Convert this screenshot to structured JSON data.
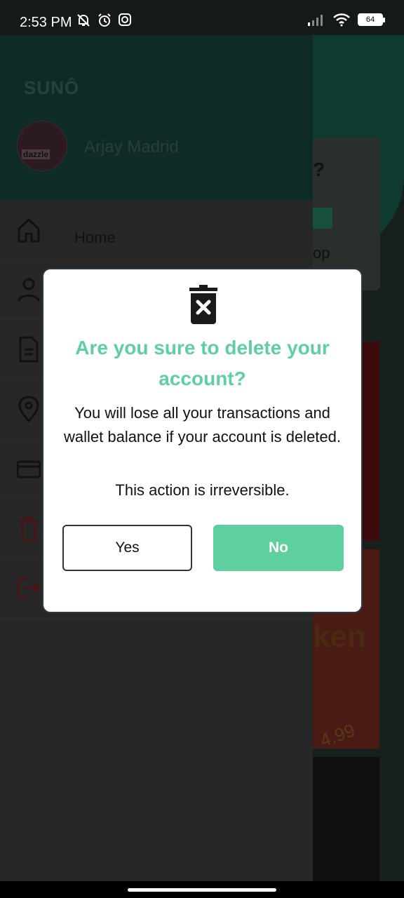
{
  "status_bar": {
    "time": "2:53 PM",
    "battery_level": "64",
    "icons": [
      "mute-icon",
      "alarm-icon",
      "instagram-icon",
      "signal-icon",
      "wifi-icon",
      "battery-icon"
    ]
  },
  "drawer": {
    "brand": "SUNÔ",
    "avatar_text": "dazzle",
    "user_name": "Arjay Madrid",
    "items": [
      {
        "label": "Home",
        "icon": "home-icon"
      },
      {
        "label": "",
        "icon": "user-icon"
      },
      {
        "label": "",
        "icon": "document-icon"
      },
      {
        "label": "",
        "icon": "location-pin-icon"
      },
      {
        "label": "",
        "icon": "credit-card-icon"
      },
      {
        "label": "",
        "icon": "trash-icon"
      },
      {
        "label": "",
        "icon": "logout-icon"
      }
    ]
  },
  "background_cards": {
    "card1_text": "?",
    "card1_sub": "op",
    "card3_text": "ken",
    "card3_price": "4.99"
  },
  "dialog": {
    "icon": "trash-delete-icon",
    "title": "Are you sure to delete your account?",
    "message": "You will lose all your transactions and wallet balance if your account is deleted.",
    "warning": "This action is irreversible.",
    "yes_label": "Yes",
    "no_label": "No"
  },
  "colors": {
    "accent": "#5ECF9F",
    "drawer_header": "#0F2B25",
    "danger": "#5A1A1A"
  }
}
